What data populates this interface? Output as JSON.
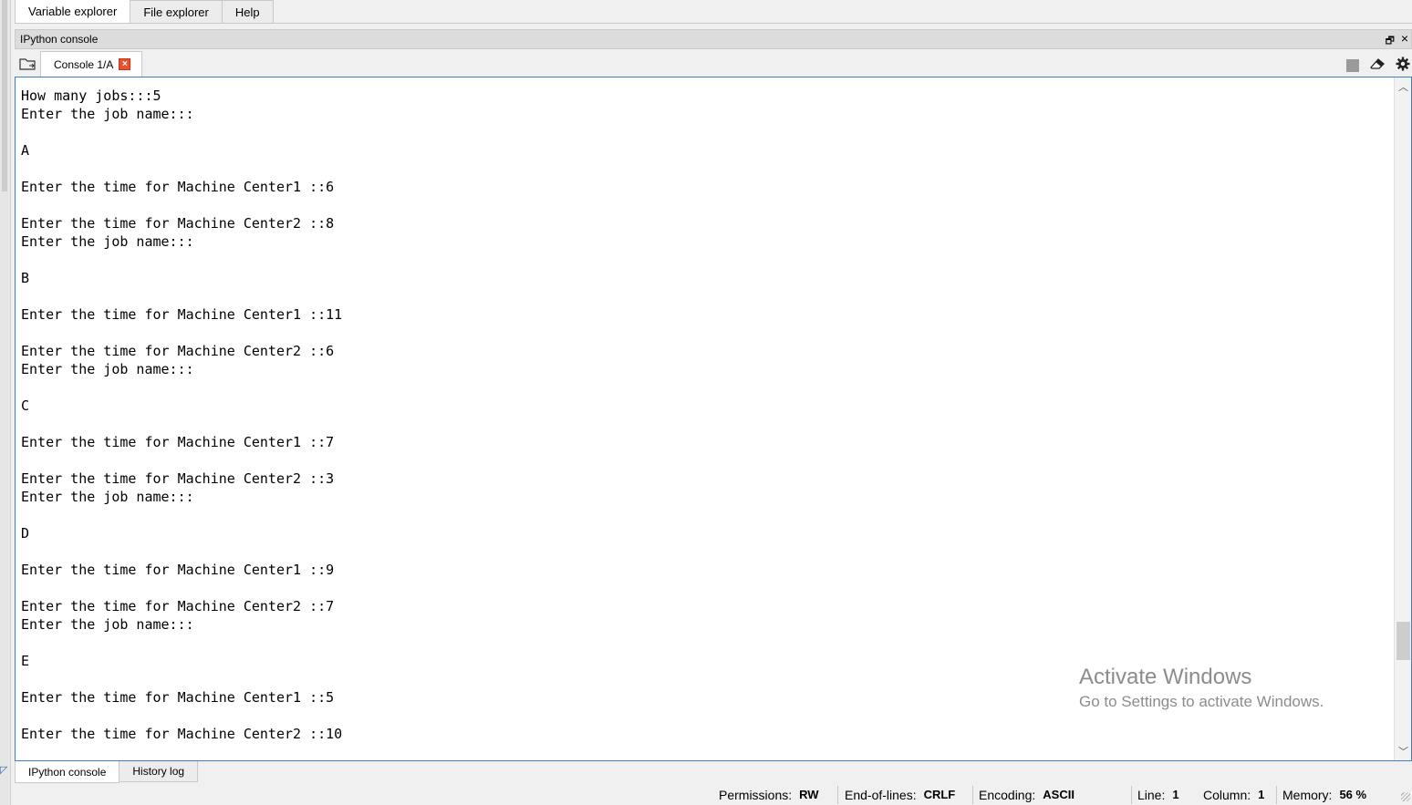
{
  "top_tabs": [
    "Variable explorer",
    "File explorer",
    "Help"
  ],
  "pane": {
    "title": "IPython console"
  },
  "console": {
    "tab_label": "Console 1/A",
    "lines": [
      "How many jobs:::5",
      "Enter the job name:::",
      "",
      "A",
      "",
      "Enter the time for Machine Center1 ::6",
      "",
      "Enter the time for Machine Center2 ::8",
      "Enter the job name:::",
      "",
      "B",
      "",
      "Enter the time for Machine Center1 ::11",
      "",
      "Enter the time for Machine Center2 ::6",
      "Enter the job name:::",
      "",
      "C",
      "",
      "Enter the time for Machine Center1 ::7",
      "",
      "Enter the time for Machine Center2 ::3",
      "Enter the job name:::",
      "",
      "D",
      "",
      "Enter the time for Machine Center1 ::9",
      "",
      "Enter the time for Machine Center2 ::7",
      "Enter the job name:::",
      "",
      "E",
      "",
      "Enter the time for Machine Center1 ::5",
      "",
      "Enter the time for Machine Center2 ::10"
    ]
  },
  "watermark": {
    "title": "Activate Windows",
    "subtitle": "Go to Settings to activate Windows."
  },
  "bottom_tabs": [
    "IPython console",
    "History log"
  ],
  "status": {
    "permissions_label": "Permissions:",
    "permissions_value": "RW",
    "eol_label": "End-of-lines:",
    "eol_value": "CRLF",
    "encoding_label": "Encoding:",
    "encoding_value": "ASCII",
    "line_label": "Line:",
    "line_value": "1",
    "column_label": "Column:",
    "column_value": "1",
    "memory_label": "Memory:",
    "memory_value": "56 %"
  },
  "icons": [
    "folder-icon",
    "close-tab-icon",
    "stop-icon",
    "eraser-icon",
    "gear-icon",
    "undock-icon",
    "close-pane-icon",
    "scroll-up-icon",
    "scroll-down-icon"
  ]
}
